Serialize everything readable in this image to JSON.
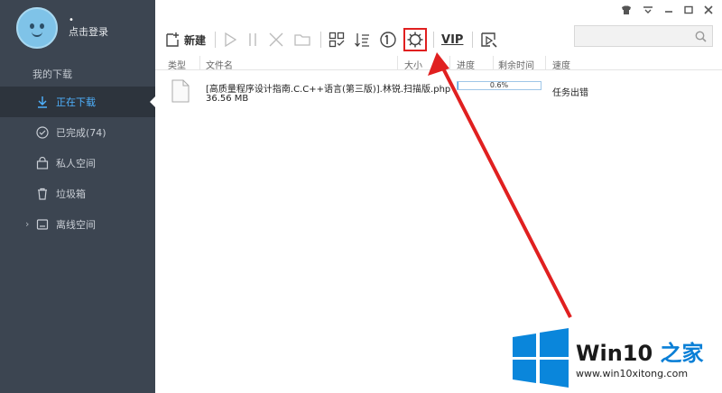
{
  "profile": {
    "dot": "•",
    "login_label": "点击登录"
  },
  "sidebar": {
    "section_title": "我的下载",
    "items": [
      {
        "label": "正在下载",
        "icon": "download-icon",
        "active": true
      },
      {
        "label": "已完成(74)",
        "icon": "check-circle-icon"
      },
      {
        "label": "私人空间",
        "icon": "lock-box-icon"
      },
      {
        "label": "垃圾箱",
        "icon": "trash-icon"
      },
      {
        "label": "离线空间",
        "icon": "cloud-icon",
        "chevron": "›"
      }
    ]
  },
  "toolbar": {
    "new_label": "新建",
    "vip_label": "VIP"
  },
  "columns": {
    "type": "类型",
    "name": "文件名",
    "size": "大小",
    "progress": "进度",
    "remaining": "剩余时间",
    "speed": "速度"
  },
  "task": {
    "name": "[高质量程序设计指南.C.C++语言(第三版)].林锐.扫描版.php",
    "size": "36.56 MB",
    "progress_text": "0.6%",
    "progress_value": 0.6,
    "status": "任务出错"
  },
  "brand": {
    "name_a": "Win10",
    "name_b": " 之家",
    "url": "www.win10xitong.com"
  },
  "colors": {
    "sidebar_bg": "#3c4551",
    "active_blue": "#4fb2ff",
    "highlight_red": "#e02020",
    "progress_fill": "#4fa3e8"
  }
}
